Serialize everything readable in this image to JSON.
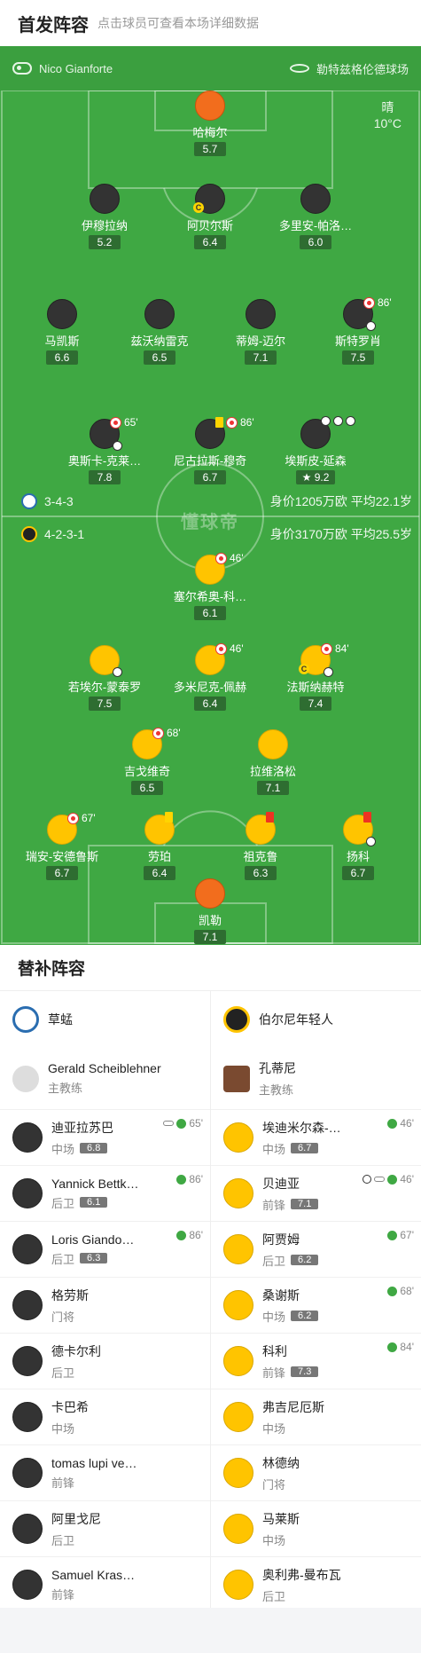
{
  "header": {
    "title": "首发阵容",
    "subtitle": "点击球员可查看本场详细数据"
  },
  "pitch_bar": {
    "referee": "Nico Gianforte",
    "stadium": "勒特兹格伦德球场"
  },
  "weather": {
    "condition": "晴",
    "temp": "10°C"
  },
  "watermark": "懂球帝",
  "home_team": {
    "formation": "3-4-3",
    "info": "身价1205万欧 平均22.1岁"
  },
  "away_team": {
    "formation": "4-2-3-1",
    "info": "身价3170万欧 平均25.5岁"
  },
  "home_players": [
    {
      "name": "哈梅尔",
      "rating": "5.7"
    },
    {
      "name": "伊穆拉纳",
      "rating": "5.2"
    },
    {
      "name": "阿贝尔斯",
      "rating": "6.4"
    },
    {
      "name": "多里安-帕洛…",
      "rating": "6.0"
    },
    {
      "name": "马凯斯",
      "rating": "6.6"
    },
    {
      "name": "兹沃纳雷克",
      "rating": "6.5"
    },
    {
      "name": "蒂姆-迈尔",
      "rating": "7.1"
    },
    {
      "name": "斯特罗肖",
      "rating": "7.5",
      "sub_min": "86'"
    },
    {
      "name": "奥斯卡-克莱…",
      "rating": "7.8",
      "sub_min": "65'"
    },
    {
      "name": "尼古拉斯-穆奇",
      "rating": "6.7",
      "sub_min": "86'"
    },
    {
      "name": "埃斯皮-延森",
      "rating": "9.2"
    }
  ],
  "away_players": [
    {
      "name": "塞尔希奥-科…",
      "rating": "6.1",
      "sub_min": "46'"
    },
    {
      "name": "若埃尔-蒙泰罗",
      "rating": "7.5"
    },
    {
      "name": "多米尼克-佩赫",
      "rating": "6.4",
      "sub_min": "46'"
    },
    {
      "name": "法斯纳赫特",
      "rating": "7.4",
      "sub_min": "84'"
    },
    {
      "name": "吉戈维奇",
      "rating": "6.5",
      "sub_min": "68'"
    },
    {
      "name": "拉维洛松",
      "rating": "7.1"
    },
    {
      "name": "瑞安-安德鲁斯",
      "rating": "6.7",
      "sub_min": "67'"
    },
    {
      "name": "劳珀",
      "rating": "6.4"
    },
    {
      "name": "祖克鲁",
      "rating": "6.3"
    },
    {
      "name": "扬科",
      "rating": "6.7"
    },
    {
      "name": "凯勒",
      "rating": "7.1"
    }
  ],
  "subs": {
    "title": "替补阵容",
    "home_team_name": "草蜢",
    "away_team_name": "伯尔尼年轻人",
    "home_coach": {
      "name": "Gerald Scheiblehner",
      "role": "主教练"
    },
    "away_coach": {
      "name": "孔蒂尼",
      "role": "主教练"
    },
    "home": [
      {
        "name": "迪亚拉苏巴",
        "pos": "中场",
        "rating": "6.8",
        "sub_min": "65'"
      },
      {
        "name": "Yannick Bettk…",
        "pos": "后卫",
        "rating": "6.1",
        "sub_min": "86'"
      },
      {
        "name": "Loris Giando…",
        "pos": "后卫",
        "rating": "6.3",
        "sub_min": "86'"
      },
      {
        "name": "格劳斯",
        "pos": "门将"
      },
      {
        "name": "德卡尔利",
        "pos": "后卫"
      },
      {
        "name": "卡巴希",
        "pos": "中场"
      },
      {
        "name": "tomas lupi ve…",
        "pos": "前锋"
      },
      {
        "name": "阿里戈尼",
        "pos": "后卫"
      },
      {
        "name": "Samuel Kras…",
        "pos": "前锋"
      }
    ],
    "away": [
      {
        "name": "埃迪米尔森-…",
        "pos": "中场",
        "rating": "6.7",
        "sub_min": "46'"
      },
      {
        "name": "贝迪亚",
        "pos": "前锋",
        "rating": "7.1",
        "sub_min": "46'"
      },
      {
        "name": "阿贾姆",
        "pos": "后卫",
        "rating": "6.2",
        "sub_min": "67'"
      },
      {
        "name": "桑谢斯",
        "pos": "中场",
        "rating": "6.2",
        "sub_min": "68'"
      },
      {
        "name": "科利",
        "pos": "前锋",
        "rating": "7.3",
        "sub_min": "84'"
      },
      {
        "name": "弗吉尼厄斯",
        "pos": "中场"
      },
      {
        "name": "林德纳",
        "pos": "门将"
      },
      {
        "name": "马莱斯",
        "pos": "中场"
      },
      {
        "name": "奥利弗-曼布瓦",
        "pos": "后卫"
      }
    ]
  }
}
